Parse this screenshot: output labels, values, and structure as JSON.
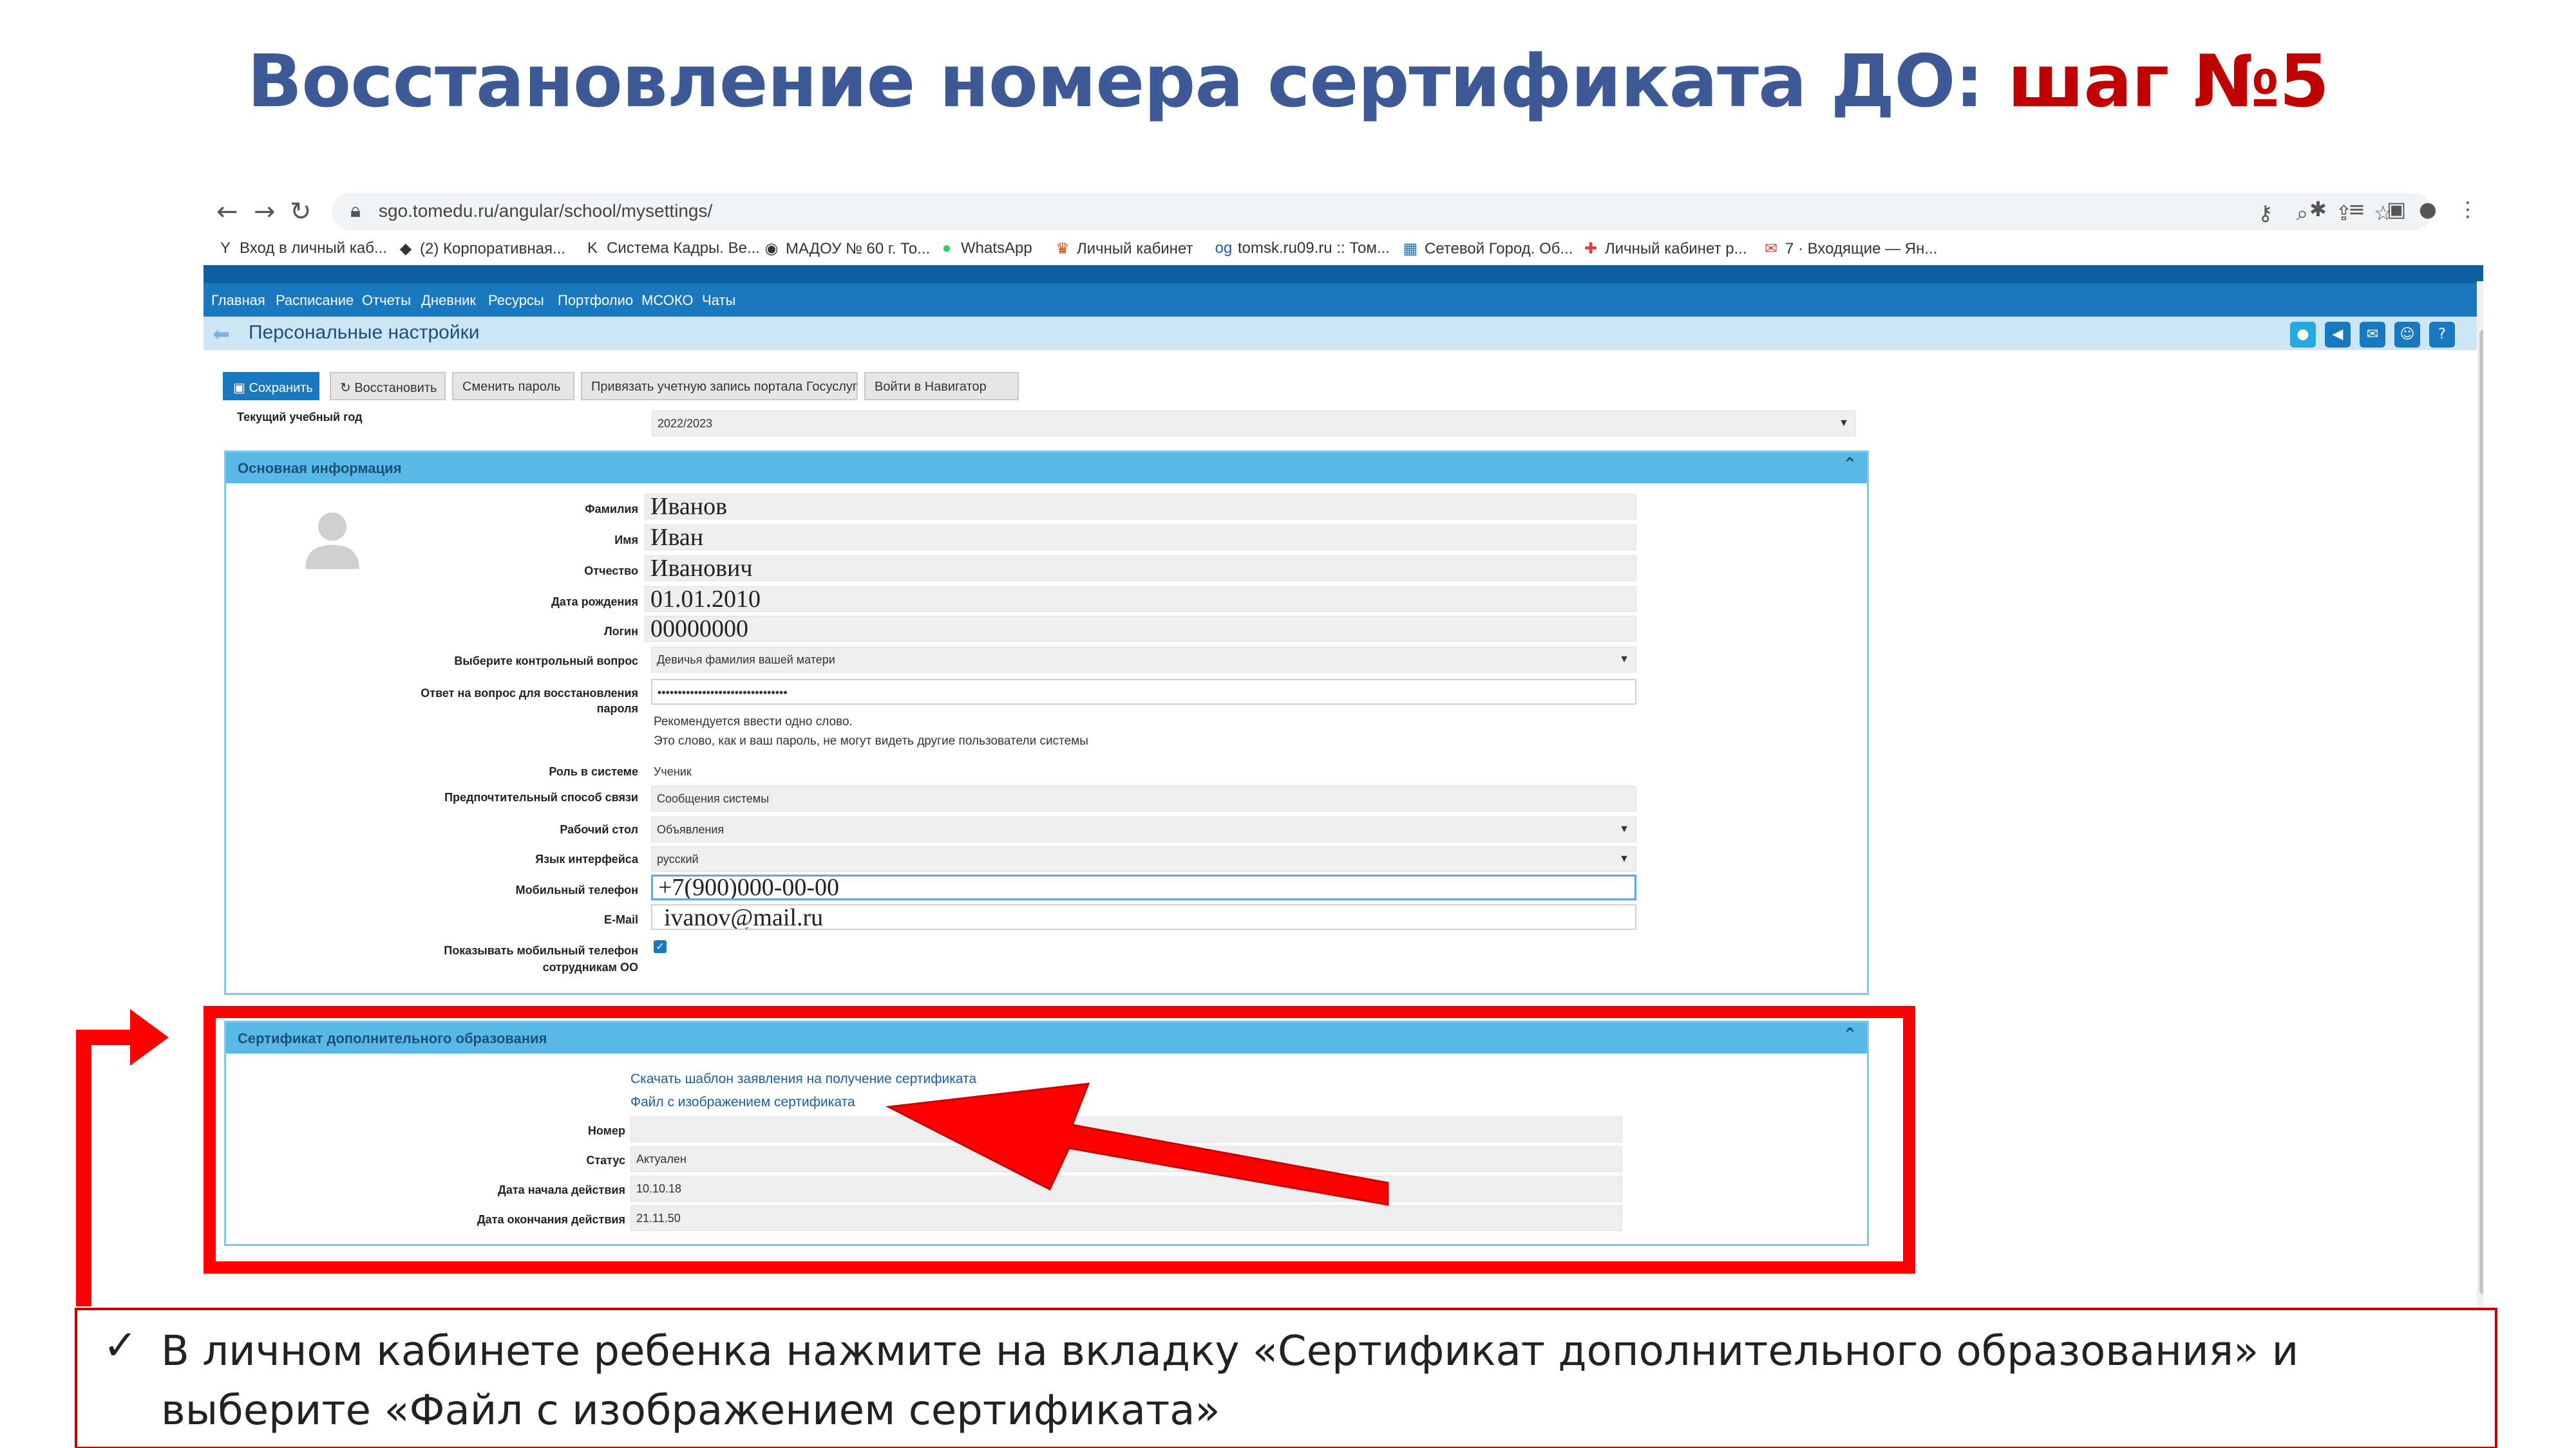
{
  "slide": {
    "title_main": "Восстановление номера сертификата ДО: ",
    "title_accent": "шаг №5",
    "instruction": "В личном кабинете ребенка нажмите на вкладку «Сертификат дополнительного образования» и выберите «Файл с изображением сертификата»"
  },
  "browser": {
    "url": "sgo.tomedu.ru/angular/school/mysettings/",
    "bookmarks": [
      {
        "icon": "Y",
        "label": "Вход в личный каб..."
      },
      {
        "icon": "◆",
        "label": "(2) Корпоративная..."
      },
      {
        "icon": "K",
        "label": "Система Кадры. Ве..."
      },
      {
        "icon": "◉",
        "label": "МАДОУ № 60 г. То..."
      },
      {
        "icon": "●",
        "label": "WhatsApp"
      },
      {
        "icon": "♛",
        "label": "Личный кабинет"
      },
      {
        "icon": "og",
        "label": "tomsk.ru09.ru :: Том..."
      },
      {
        "icon": "▦",
        "label": "Сетевой Город. Об..."
      },
      {
        "icon": "✚",
        "label": "Личный кабинет р..."
      },
      {
        "icon": "✉",
        "label": "7 · Входящие — Ян..."
      }
    ]
  },
  "app": {
    "menu": [
      "Главная",
      "Расписание",
      "Отчеты",
      "Дневник",
      "Ресурсы",
      "Портфолио",
      "МСОКО",
      "Чаты"
    ],
    "page_title": "Персональные настройки",
    "actions": [
      "Сохранить",
      "Восстановить",
      "Сменить пароль",
      "Привязать учетную запись портала Госуслуг",
      "Войти в Навигатор"
    ],
    "year_label": "Текущий учебный год",
    "year_value": "2022/2023",
    "main_panel": {
      "title": "Основная информация",
      "last_name_label": "Фамилия",
      "last_name": "Иванов",
      "first_name_label": "Имя",
      "first_name": "Иван",
      "patronymic_label": "Отчество",
      "patronymic": "Иванович",
      "birth_label": "Дата рождения",
      "birth": "01.01.2010",
      "login_label": "Логин",
      "login": "00000000",
      "question_label": "Выберите контрольный вопрос",
      "question": "Девичья фамилия вашей матери",
      "answer_label_1": "Ответ на вопрос для восстановления",
      "answer_label_2": "пароля",
      "answer": "••••••••••••••••••••••••••••••••",
      "hint_1": "Рекомендуется ввести одно слово.",
      "hint_2": "Это слово, как и ваш пароль, не могут видеть другие пользователи системы",
      "role_label": "Роль в системе",
      "role": "Ученик",
      "contact_label": "Предпочтительный способ связи",
      "contact": "Сообщения системы",
      "desk_label": "Рабочий стол",
      "desk": "Объявления",
      "lang_label": "Язык интерфейса",
      "lang": "русский",
      "phone_label": "Мобильный телефон",
      "phone": "+7(900)000-00-00",
      "email_label": "E-Mail",
      "email": "ivanov@mail.ru",
      "show_phone_label_1": "Показывать мобильный телефон",
      "show_phone_label_2": "сотрудникам ОО"
    },
    "cert_panel": {
      "title": "Сертификат дополнительного образования",
      "link_template": "Скачать шаблон заявления на получение сертификата",
      "link_file": "Файл с изображением сертификата",
      "number_label": "Номер",
      "status_label": "Статус",
      "status": "Актуален",
      "start_label": "Дата начала действия",
      "start": "10.10.18",
      "end_label": "Дата окончания действия",
      "end": "21.11.50"
    }
  },
  "colors": {
    "title_blue": "#3d5a96",
    "title_red": "#c00000",
    "highlight_red": "#ff0000",
    "app_blue": "#1a78bf",
    "panel_head": "#58b9e6"
  }
}
